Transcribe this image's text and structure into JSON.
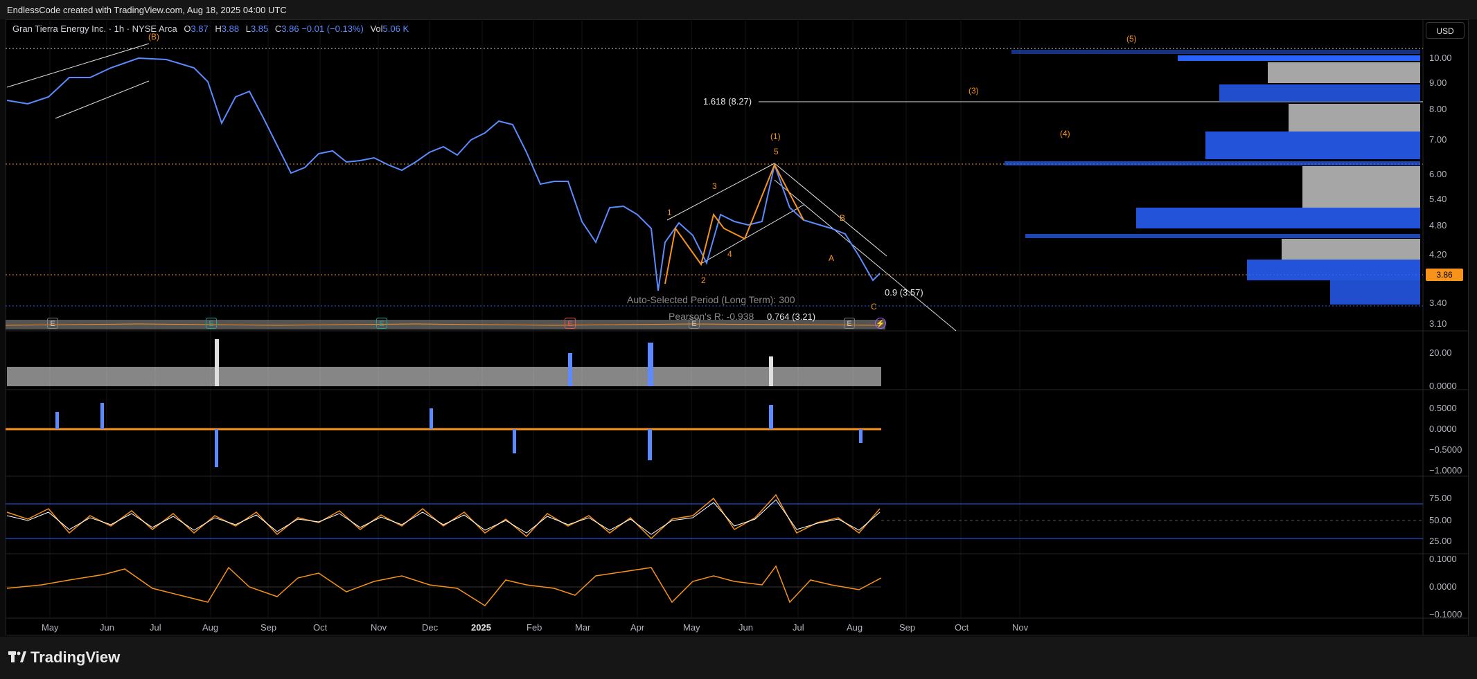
{
  "header": {
    "credit": "EndlessCode created with TradingView.com, Aug 18, 2025 04:00 UTC"
  },
  "legend": {
    "name": "Gran Tierra Energy Inc. · 1h · NYSE Arca",
    "o_label": "O",
    "o": "3.87",
    "h_label": "H",
    "h": "3.88",
    "l_label": "L",
    "l": "3.85",
    "c_label": "C",
    "c": "3.86",
    "change": "−0.01 (−0.13%)",
    "vol_label": "Vol",
    "vol": "5.06 K"
  },
  "currency": "USD",
  "last_price": "3.86",
  "price_axis": [
    "10.00",
    "9.00",
    "8.00",
    "7.00",
    "6.00",
    "5.40",
    "4.80",
    "4.20",
    "3.40",
    "3.10"
  ],
  "pane2_axis": [
    "20.00",
    "0.0000"
  ],
  "pane3_axis": [
    "0.5000",
    "0.0000",
    "−0.5000",
    "−1.0000"
  ],
  "pane4_axis": [
    "75.00",
    "50.00",
    "25.00"
  ],
  "pane5_axis": [
    "0.1000",
    "0.0000",
    "−0.1000"
  ],
  "time_axis": [
    "May",
    "Jun",
    "Jul",
    "Aug",
    "Sep",
    "Oct",
    "Nov",
    "Dec",
    "2025",
    "Feb",
    "Mar",
    "Apr",
    "May",
    "Jun",
    "Jul",
    "Aug",
    "Sep",
    "Oct",
    "Nov"
  ],
  "waves": {
    "b_top": "(B)",
    "w5": "(5)",
    "w3": "(3)",
    "w4": "(4)",
    "w1": "(1)",
    "s1": "1",
    "s2": "2",
    "s3": "3",
    "s4": "4",
    "s5": "5",
    "a": "A",
    "b": "B",
    "c": "C"
  },
  "annotations": {
    "fib_ext": "1.618 (8.27)",
    "fib_09": "0.9 (3.57)",
    "fib_0764": "0.764 (3.21)",
    "auto_period": "Auto-Selected Period (Long Term): 300",
    "pearson": "Pearson's R: -0.938"
  },
  "events": [
    "E",
    "E",
    "E",
    "E",
    "E",
    "E"
  ],
  "footer": {
    "brand": "TradingView"
  },
  "colors": {
    "accent": "#f7931a",
    "blue": "#2962ff",
    "bg": "#000000"
  }
}
